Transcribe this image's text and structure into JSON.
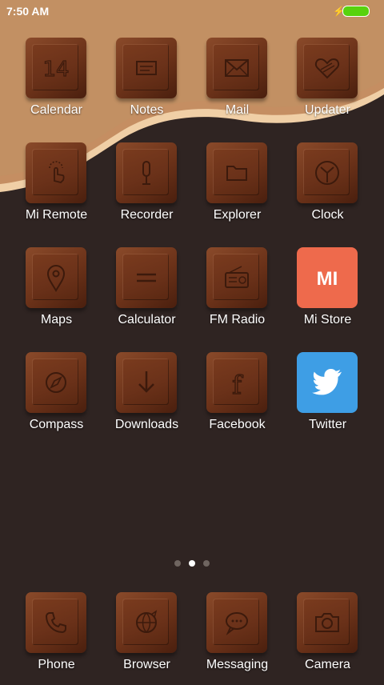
{
  "status_bar": {
    "time": "7:50 AM",
    "battery_color": "#58d20e"
  },
  "page_indicator": {
    "pages": 3,
    "active_index": 1
  },
  "apps": [
    {
      "label": "Calendar",
      "icon": "calendar-icon",
      "icon_text": "14"
    },
    {
      "label": "Notes",
      "icon": "notes-icon"
    },
    {
      "label": "Mail",
      "icon": "mail-icon"
    },
    {
      "label": "Updater",
      "icon": "updater-icon"
    },
    {
      "label": "Mi Remote",
      "icon": "mi-remote-icon"
    },
    {
      "label": "Recorder",
      "icon": "microphone-icon"
    },
    {
      "label": "Explorer",
      "icon": "folder-icon"
    },
    {
      "label": "Clock",
      "icon": "clock-icon"
    },
    {
      "label": "Maps",
      "icon": "map-pin-icon"
    },
    {
      "label": "Calculator",
      "icon": "calculator-icon"
    },
    {
      "label": "FM Radio",
      "icon": "radio-icon"
    },
    {
      "label": "Mi Store",
      "icon": "mi-logo-icon",
      "icon_text": "MI",
      "color": "#ee6a4c"
    },
    {
      "label": "Compass",
      "icon": "compass-icon"
    },
    {
      "label": "Downloads",
      "icon": "download-arrow-icon"
    },
    {
      "label": "Facebook",
      "icon": "facebook-icon",
      "icon_text": "f"
    },
    {
      "label": "Twitter",
      "icon": "twitter-bird-icon",
      "color": "#3e9ee5"
    }
  ],
  "dock": [
    {
      "label": "Phone",
      "icon": "phone-icon"
    },
    {
      "label": "Browser",
      "icon": "browser-icon"
    },
    {
      "label": "Messaging",
      "icon": "message-bubble-icon"
    },
    {
      "label": "Camera",
      "icon": "camera-icon"
    }
  ]
}
